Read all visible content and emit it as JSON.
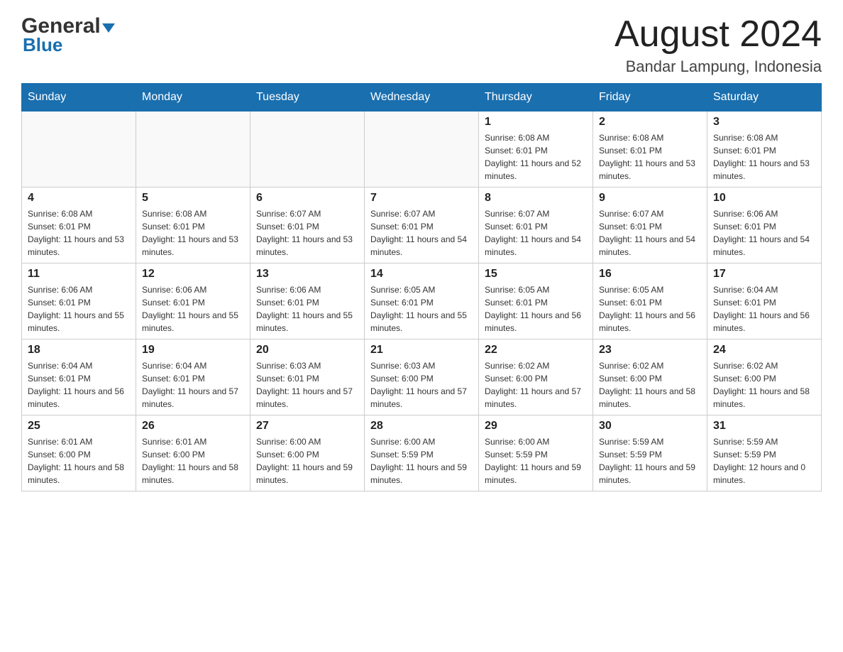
{
  "header": {
    "logo_general": "General",
    "logo_blue": "Blue",
    "title": "August 2024",
    "location": "Bandar Lampung, Indonesia"
  },
  "weekdays": [
    "Sunday",
    "Monday",
    "Tuesday",
    "Wednesday",
    "Thursday",
    "Friday",
    "Saturday"
  ],
  "weeks": [
    [
      {
        "day": "",
        "sunrise": "",
        "sunset": "",
        "daylight": ""
      },
      {
        "day": "",
        "sunrise": "",
        "sunset": "",
        "daylight": ""
      },
      {
        "day": "",
        "sunrise": "",
        "sunset": "",
        "daylight": ""
      },
      {
        "day": "",
        "sunrise": "",
        "sunset": "",
        "daylight": ""
      },
      {
        "day": "1",
        "sunrise": "Sunrise: 6:08 AM",
        "sunset": "Sunset: 6:01 PM",
        "daylight": "Daylight: 11 hours and 52 minutes."
      },
      {
        "day": "2",
        "sunrise": "Sunrise: 6:08 AM",
        "sunset": "Sunset: 6:01 PM",
        "daylight": "Daylight: 11 hours and 53 minutes."
      },
      {
        "day": "3",
        "sunrise": "Sunrise: 6:08 AM",
        "sunset": "Sunset: 6:01 PM",
        "daylight": "Daylight: 11 hours and 53 minutes."
      }
    ],
    [
      {
        "day": "4",
        "sunrise": "Sunrise: 6:08 AM",
        "sunset": "Sunset: 6:01 PM",
        "daylight": "Daylight: 11 hours and 53 minutes."
      },
      {
        "day": "5",
        "sunrise": "Sunrise: 6:08 AM",
        "sunset": "Sunset: 6:01 PM",
        "daylight": "Daylight: 11 hours and 53 minutes."
      },
      {
        "day": "6",
        "sunrise": "Sunrise: 6:07 AM",
        "sunset": "Sunset: 6:01 PM",
        "daylight": "Daylight: 11 hours and 53 minutes."
      },
      {
        "day": "7",
        "sunrise": "Sunrise: 6:07 AM",
        "sunset": "Sunset: 6:01 PM",
        "daylight": "Daylight: 11 hours and 54 minutes."
      },
      {
        "day": "8",
        "sunrise": "Sunrise: 6:07 AM",
        "sunset": "Sunset: 6:01 PM",
        "daylight": "Daylight: 11 hours and 54 minutes."
      },
      {
        "day": "9",
        "sunrise": "Sunrise: 6:07 AM",
        "sunset": "Sunset: 6:01 PM",
        "daylight": "Daylight: 11 hours and 54 minutes."
      },
      {
        "day": "10",
        "sunrise": "Sunrise: 6:06 AM",
        "sunset": "Sunset: 6:01 PM",
        "daylight": "Daylight: 11 hours and 54 minutes."
      }
    ],
    [
      {
        "day": "11",
        "sunrise": "Sunrise: 6:06 AM",
        "sunset": "Sunset: 6:01 PM",
        "daylight": "Daylight: 11 hours and 55 minutes."
      },
      {
        "day": "12",
        "sunrise": "Sunrise: 6:06 AM",
        "sunset": "Sunset: 6:01 PM",
        "daylight": "Daylight: 11 hours and 55 minutes."
      },
      {
        "day": "13",
        "sunrise": "Sunrise: 6:06 AM",
        "sunset": "Sunset: 6:01 PM",
        "daylight": "Daylight: 11 hours and 55 minutes."
      },
      {
        "day": "14",
        "sunrise": "Sunrise: 6:05 AM",
        "sunset": "Sunset: 6:01 PM",
        "daylight": "Daylight: 11 hours and 55 minutes."
      },
      {
        "day": "15",
        "sunrise": "Sunrise: 6:05 AM",
        "sunset": "Sunset: 6:01 PM",
        "daylight": "Daylight: 11 hours and 56 minutes."
      },
      {
        "day": "16",
        "sunrise": "Sunrise: 6:05 AM",
        "sunset": "Sunset: 6:01 PM",
        "daylight": "Daylight: 11 hours and 56 minutes."
      },
      {
        "day": "17",
        "sunrise": "Sunrise: 6:04 AM",
        "sunset": "Sunset: 6:01 PM",
        "daylight": "Daylight: 11 hours and 56 minutes."
      }
    ],
    [
      {
        "day": "18",
        "sunrise": "Sunrise: 6:04 AM",
        "sunset": "Sunset: 6:01 PM",
        "daylight": "Daylight: 11 hours and 56 minutes."
      },
      {
        "day": "19",
        "sunrise": "Sunrise: 6:04 AM",
        "sunset": "Sunset: 6:01 PM",
        "daylight": "Daylight: 11 hours and 57 minutes."
      },
      {
        "day": "20",
        "sunrise": "Sunrise: 6:03 AM",
        "sunset": "Sunset: 6:01 PM",
        "daylight": "Daylight: 11 hours and 57 minutes."
      },
      {
        "day": "21",
        "sunrise": "Sunrise: 6:03 AM",
        "sunset": "Sunset: 6:00 PM",
        "daylight": "Daylight: 11 hours and 57 minutes."
      },
      {
        "day": "22",
        "sunrise": "Sunrise: 6:02 AM",
        "sunset": "Sunset: 6:00 PM",
        "daylight": "Daylight: 11 hours and 57 minutes."
      },
      {
        "day": "23",
        "sunrise": "Sunrise: 6:02 AM",
        "sunset": "Sunset: 6:00 PM",
        "daylight": "Daylight: 11 hours and 58 minutes."
      },
      {
        "day": "24",
        "sunrise": "Sunrise: 6:02 AM",
        "sunset": "Sunset: 6:00 PM",
        "daylight": "Daylight: 11 hours and 58 minutes."
      }
    ],
    [
      {
        "day": "25",
        "sunrise": "Sunrise: 6:01 AM",
        "sunset": "Sunset: 6:00 PM",
        "daylight": "Daylight: 11 hours and 58 minutes."
      },
      {
        "day": "26",
        "sunrise": "Sunrise: 6:01 AM",
        "sunset": "Sunset: 6:00 PM",
        "daylight": "Daylight: 11 hours and 58 minutes."
      },
      {
        "day": "27",
        "sunrise": "Sunrise: 6:00 AM",
        "sunset": "Sunset: 6:00 PM",
        "daylight": "Daylight: 11 hours and 59 minutes."
      },
      {
        "day": "28",
        "sunrise": "Sunrise: 6:00 AM",
        "sunset": "Sunset: 5:59 PM",
        "daylight": "Daylight: 11 hours and 59 minutes."
      },
      {
        "day": "29",
        "sunrise": "Sunrise: 6:00 AM",
        "sunset": "Sunset: 5:59 PM",
        "daylight": "Daylight: 11 hours and 59 minutes."
      },
      {
        "day": "30",
        "sunrise": "Sunrise: 5:59 AM",
        "sunset": "Sunset: 5:59 PM",
        "daylight": "Daylight: 11 hours and 59 minutes."
      },
      {
        "day": "31",
        "sunrise": "Sunrise: 5:59 AM",
        "sunset": "Sunset: 5:59 PM",
        "daylight": "Daylight: 12 hours and 0 minutes."
      }
    ]
  ]
}
